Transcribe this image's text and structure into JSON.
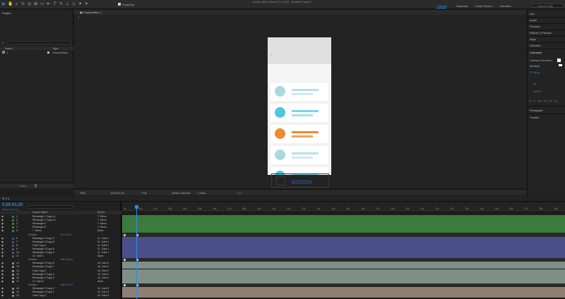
{
  "app": {
    "title": "Adobe After Effects CC 2018 - Untitled Project *"
  },
  "toolbar": {
    "snapping_label": "Snapping",
    "workspaces": [
      "Default",
      "Standard",
      "Small Screen",
      "Libraries"
    ],
    "active_workspace": "Default",
    "search_placeholder": "Search Help"
  },
  "project_panel": {
    "title": "Project",
    "columns": {
      "name": "Name",
      "type": "Type"
    },
    "items": [
      {
        "name": "1",
        "type": "Composition"
      }
    ]
  },
  "viewer": {
    "tab_label": "Composition 1",
    "sub_tab": "1",
    "zoom": "25%",
    "timecode": "0;00;01;20",
    "resolution": "Full",
    "camera": "Active Camera",
    "views": "1 View",
    "offset": "+0.0"
  },
  "right_panels": {
    "items": [
      "Info",
      "Audio",
      "Preview",
      "Effects & Presets",
      "Align",
      "Libraries",
      "Character",
      "Paragraph",
      "Tracker"
    ],
    "character": {
      "font": "Gotham Rounded",
      "style": "Medium",
      "size": "48 px",
      "tracking": "100 %",
      "leading_unit": "px"
    }
  },
  "timeline": {
    "tab_label": "1",
    "timecode": "0;00;01;20",
    "frame_info": "00050 (29.97 fps)",
    "columns": {
      "source_name": "Source Name",
      "parent": "Parent"
    },
    "ruler_ticks": [
      "0s",
      "01s",
      "02s",
      "03s",
      "04s",
      "05s",
      "06s",
      "07s",
      "08s",
      "09s",
      "10s",
      "11s",
      "12s",
      "13s",
      "14s",
      "15s",
      "16s",
      "17s",
      "18s",
      "19s",
      "20s",
      "21s",
      "22s",
      "23s",
      "24s",
      "25s",
      "26s",
      "27s",
      "28s",
      "29s"
    ],
    "layers": [
      {
        "num": "1",
        "name": "Rectangle 1 Copy 11",
        "parent": "7. Menu",
        "color": "#3d7a3d"
      },
      {
        "num": "2",
        "name": "Rectangle 1 Copy 10",
        "parent": "7. Menu",
        "color": "#3d7a3d"
      },
      {
        "num": "3",
        "name": "Rectangle 9",
        "parent": "7. Menu",
        "color": "#3d7a3d"
      },
      {
        "num": "4",
        "name": "Rectangle 8",
        "parent": "7. Menu",
        "color": "#3d7a3d"
      },
      {
        "num": "5",
        "name": "7. Menu",
        "parent": "None",
        "color": "#3d7a3d"
      },
      {
        "prop": "Position",
        "value": "49.0,240.0",
        "color": "#2a2a2a"
      },
      {
        "num": "6",
        "name": "Rectangle 3 Copy 9",
        "parent": "11. Card 1",
        "color": "#4a4f8a"
      },
      {
        "num": "7",
        "name": "Rectangle 3 Copy 8",
        "parent": "11. Card 1",
        "color": "#4a4f8a"
      },
      {
        "num": "8",
        "name": "Oval Copy 4",
        "parent": "11. Card 1",
        "color": "#4a4f8a"
      },
      {
        "num": "9",
        "name": "Rectangle 3 Copy 6",
        "parent": "11. Card 1",
        "color": "#4a4f8a"
      },
      {
        "num": "10",
        "name": "Rectangle 3 Copy 5",
        "parent": "11. Card 1",
        "color": "#4a4f8a"
      },
      {
        "num": "11",
        "name": "11. Card 1",
        "parent": "None",
        "color": "#4a4f8a"
      },
      {
        "prop": "Position",
        "value": "188.0,336.0",
        "color": "#2a2a2a"
      },
      {
        "num": "12",
        "name": "Rectangle 3 Copy 8",
        "parent": "16. Card 2",
        "color": "#7f8f88"
      },
      {
        "num": "13",
        "name": "Rectangle 3 Copy 7",
        "parent": "16. Card 2",
        "color": "#7f8f88"
      },
      {
        "num": "14",
        "name": "Oval Copy 3",
        "parent": "16. Card 2",
        "color": "#7f8f88"
      },
      {
        "num": "15",
        "name": "Rectangle 3 Copy 4",
        "parent": "16. Card 2",
        "color": "#7f8f88"
      },
      {
        "num": "16",
        "name": "Rectangle 3 Copy 3",
        "parent": "16. Card 2",
        "color": "#7f8f88"
      },
      {
        "num": "17",
        "name": "17. Card 2",
        "parent": "None",
        "color": "#7f8f88"
      },
      {
        "prop": "Position",
        "value": "188.0,416.0",
        "color": "#2a2a2a"
      },
      {
        "num": "18",
        "name": "Rectangle 3 Copy 2",
        "parent": "22. Card 3",
        "color": "#8f7f72"
      },
      {
        "num": "19",
        "name": "Rectangle 3 Copy 1",
        "parent": "22. Card 3",
        "color": "#8f7f72"
      },
      {
        "num": "20",
        "name": "Oval Copy 2",
        "parent": "22. Card 3",
        "color": "#8f7f72"
      }
    ]
  },
  "mockup": {
    "cards": [
      {
        "dot": "#a8dadc",
        "bar": "#b8e0e3"
      },
      {
        "dot": "#4ec6e0",
        "bar": "#7dd3e8"
      },
      {
        "dot": "#f08a2c",
        "bar": "#f0a055"
      },
      {
        "dot": "#a8dadc",
        "bar": "#b8e0e3"
      },
      {
        "dot": "#4ec6e0",
        "bar": "#7dd3e8"
      }
    ]
  },
  "colors": {
    "accent": "#2d8ceb"
  }
}
